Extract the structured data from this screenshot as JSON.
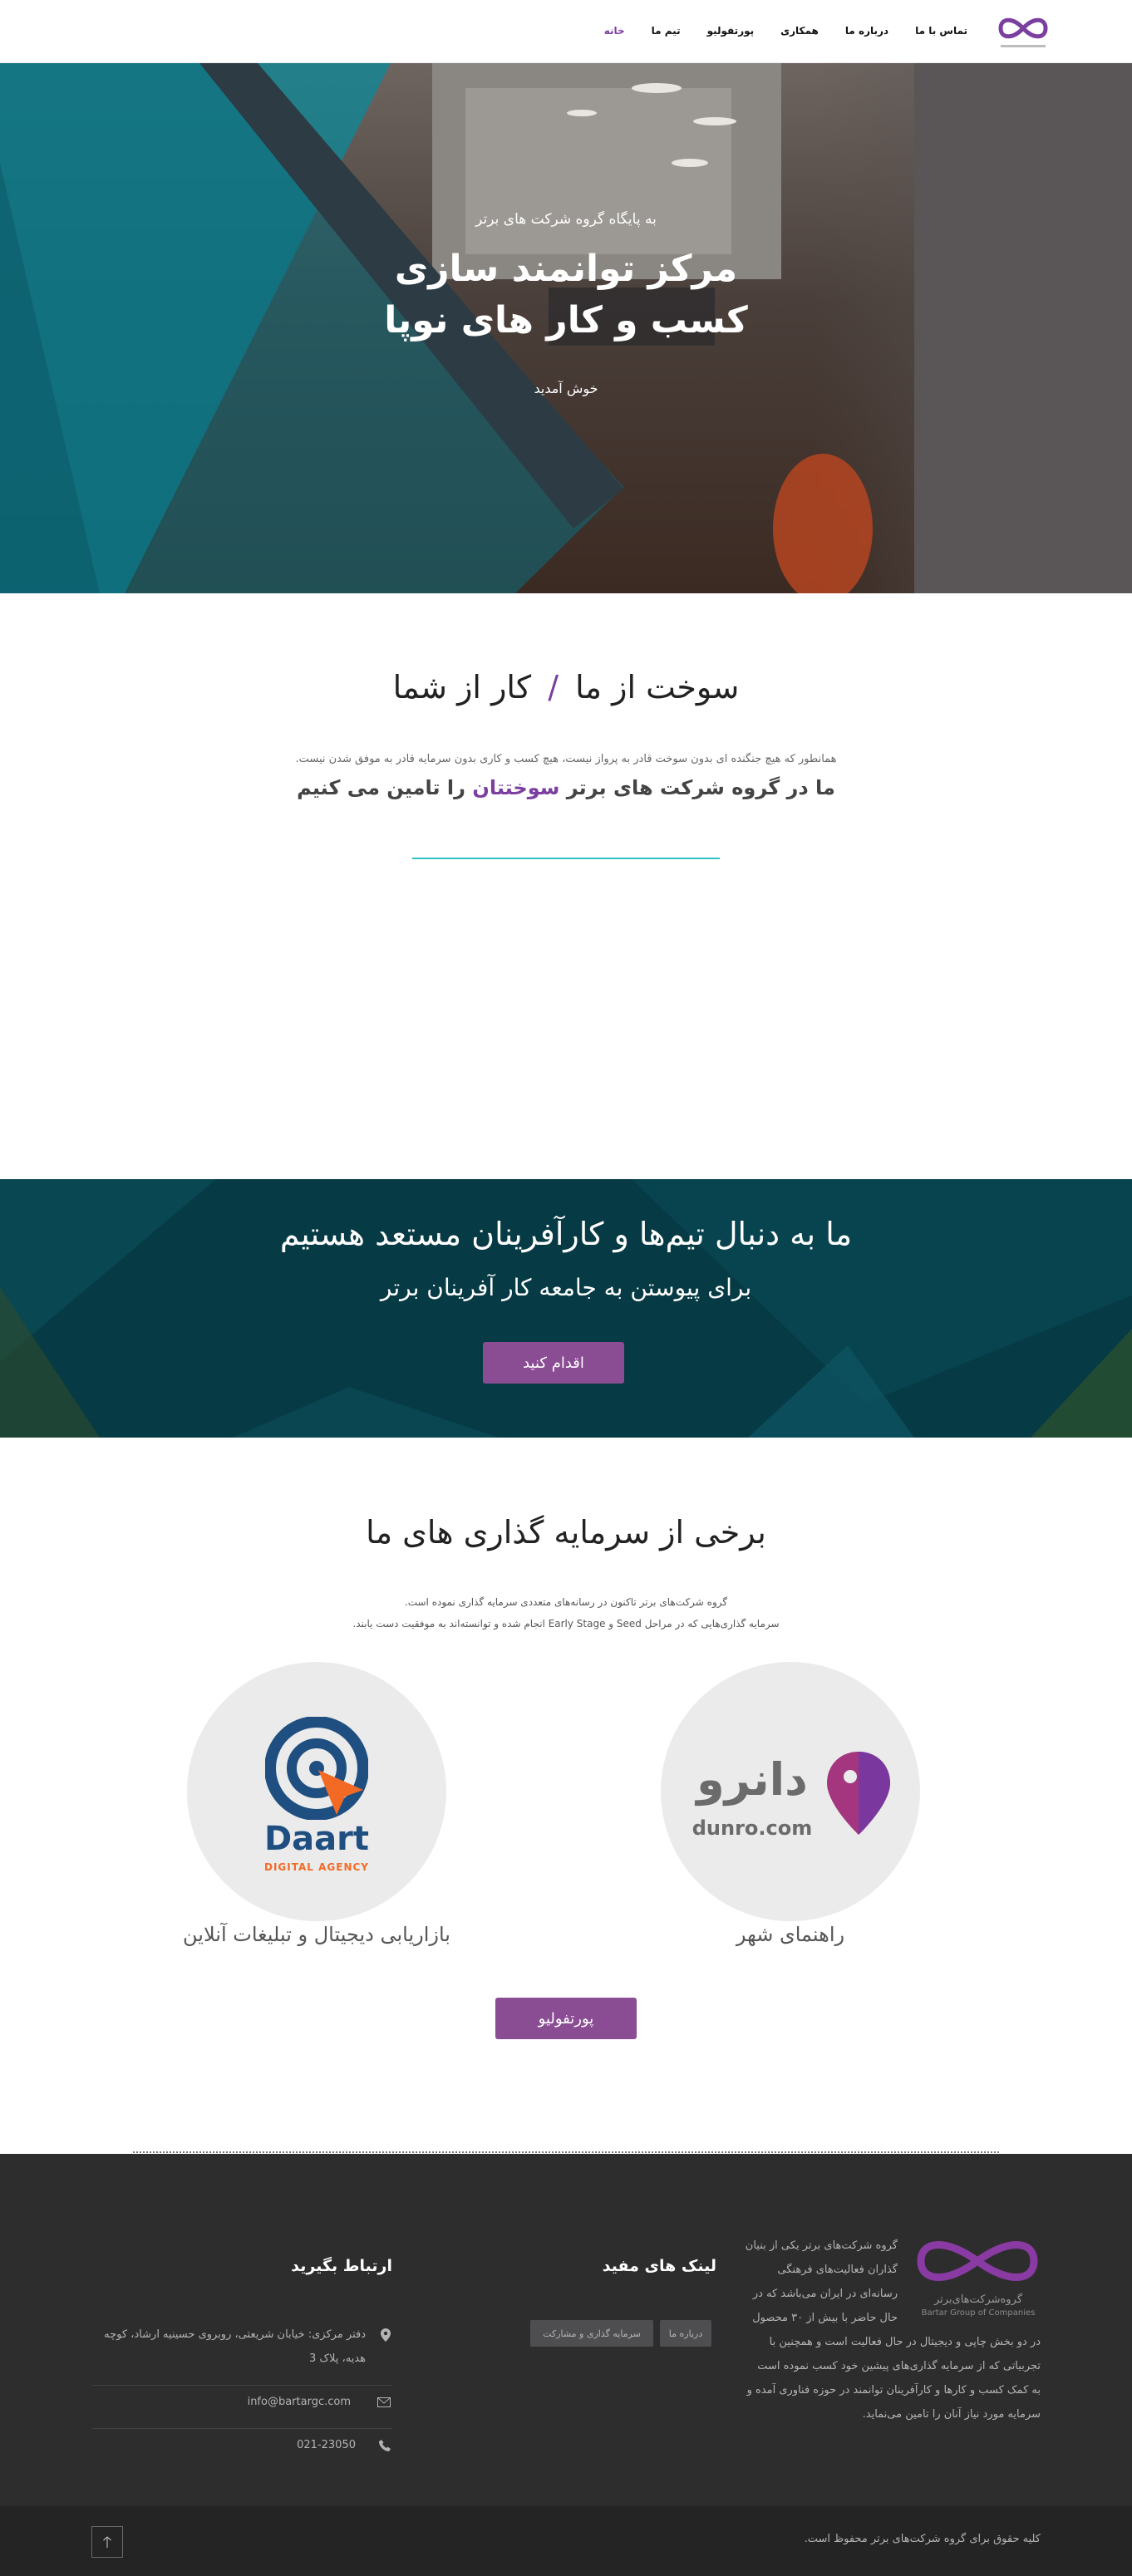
{
  "nav": {
    "items": [
      "خانه",
      "تیم ما",
      "پورتفولیو",
      "همکاری",
      "درباره ما",
      "تماس با ما"
    ],
    "active_index": 0
  },
  "logo": {
    "caption": "گروه شرکت‌های برتر"
  },
  "hero": {
    "kicker": "به پایگاه گروه شرکت های برتر",
    "title_line1": "مرکز توانمند سازی",
    "title_line2": "کسب و کار های نوپا",
    "welcome": "خوش آمدید"
  },
  "fuel": {
    "title_part1": "سوخت از ما",
    "title_sep": "/",
    "title_part2": "کار از شما",
    "desc": "همانطور که هیچ جنگنده ای بدون سوخت قادر به پرواز نیست، هیچ کسب و کاری بدون سرمایه قادر به موفق شدن نیست.",
    "tag_pre": "ما در گروه شرکت های برتر",
    "tag_highlight": "سوختتان",
    "tag_post": "را تامین می کنیم"
  },
  "cta": {
    "title": "ما به دنبال تیم‌ها و کارآفرینان مستعد هستیم",
    "subtitle": "برای پیوستن به جامعه کار آفرینان برتر",
    "button": "اقدام کنید"
  },
  "investments": {
    "title": "برخی از سرمایه گذاری های ما",
    "desc_line1": "گروه شرکت‌های برتر تاکنون در رسانه‌های متعددی سرمایه گذاری نموده است.",
    "desc_line2": "سرمایه گذاری‌هایی که در مراحل Seed و Early Stage انجام شده و توانسته‌اند به موفقیت دست یابند.",
    "items": [
      {
        "caption": "راهنمای شهر",
        "logo_text": "دانرو",
        "logo_domain": "dunro.com"
      },
      {
        "caption": "بازاریابی دیجیتال و تبلیغات آنلاین",
        "logo_text": "Daart",
        "logo_sub": "DIGITAL AGENCY"
      }
    ],
    "button": "پورتفولیو"
  },
  "footer": {
    "logo_caption": "گروه‌شرکت‌های‌برتر",
    "logo_caption_en": "Bartar Group of Companies",
    "about": [
      "گروه شرکت‌های برتر یکی از بنیان",
      "گذاران فعالیت‌های فرهنگی",
      "رسانه‌ای در ایران می‌باشد که در",
      "حال حاضر با بیش از ۳۰ محصول",
      "در دو بخش چاپی و دیجیتال در حال فعالیت است و همچنین با",
      "تجربیاتی که از سرمایه گذاری‌های پیشین خود کسب نموده است",
      "به کمک کسب و کارها و کارآفرینان توانمند در حوزه فناوری آمده و",
      "سرمایه مورد نیاز آنان را تامین می‌نماید."
    ],
    "links_title": "لینک های مفید",
    "links": [
      "درباره ما",
      "سرمایه گذاری و مشارکت"
    ],
    "contact_title": "ارتباط بگیرید",
    "address_line1": "دفتر مرکزی: خیابان شریعتی، روبروی حسینیه ارشاد، کوچه",
    "address_line2": "هدیه، پلاک 3",
    "email": "info@bartargc.com",
    "phone": "021-23050",
    "copyright": "کلیه حقوق برای گروه شرکت‌های برتر محفوظ است.",
    "scroll_top_icon": "arrow-up-icon"
  },
  "colors": {
    "brand_purple": "#7b3fa0",
    "button_purple": "#8a4c93",
    "teal_line": "#2bc4c1",
    "cta_bg": "#063a44",
    "footer_bg": "#2d2d2e"
  }
}
